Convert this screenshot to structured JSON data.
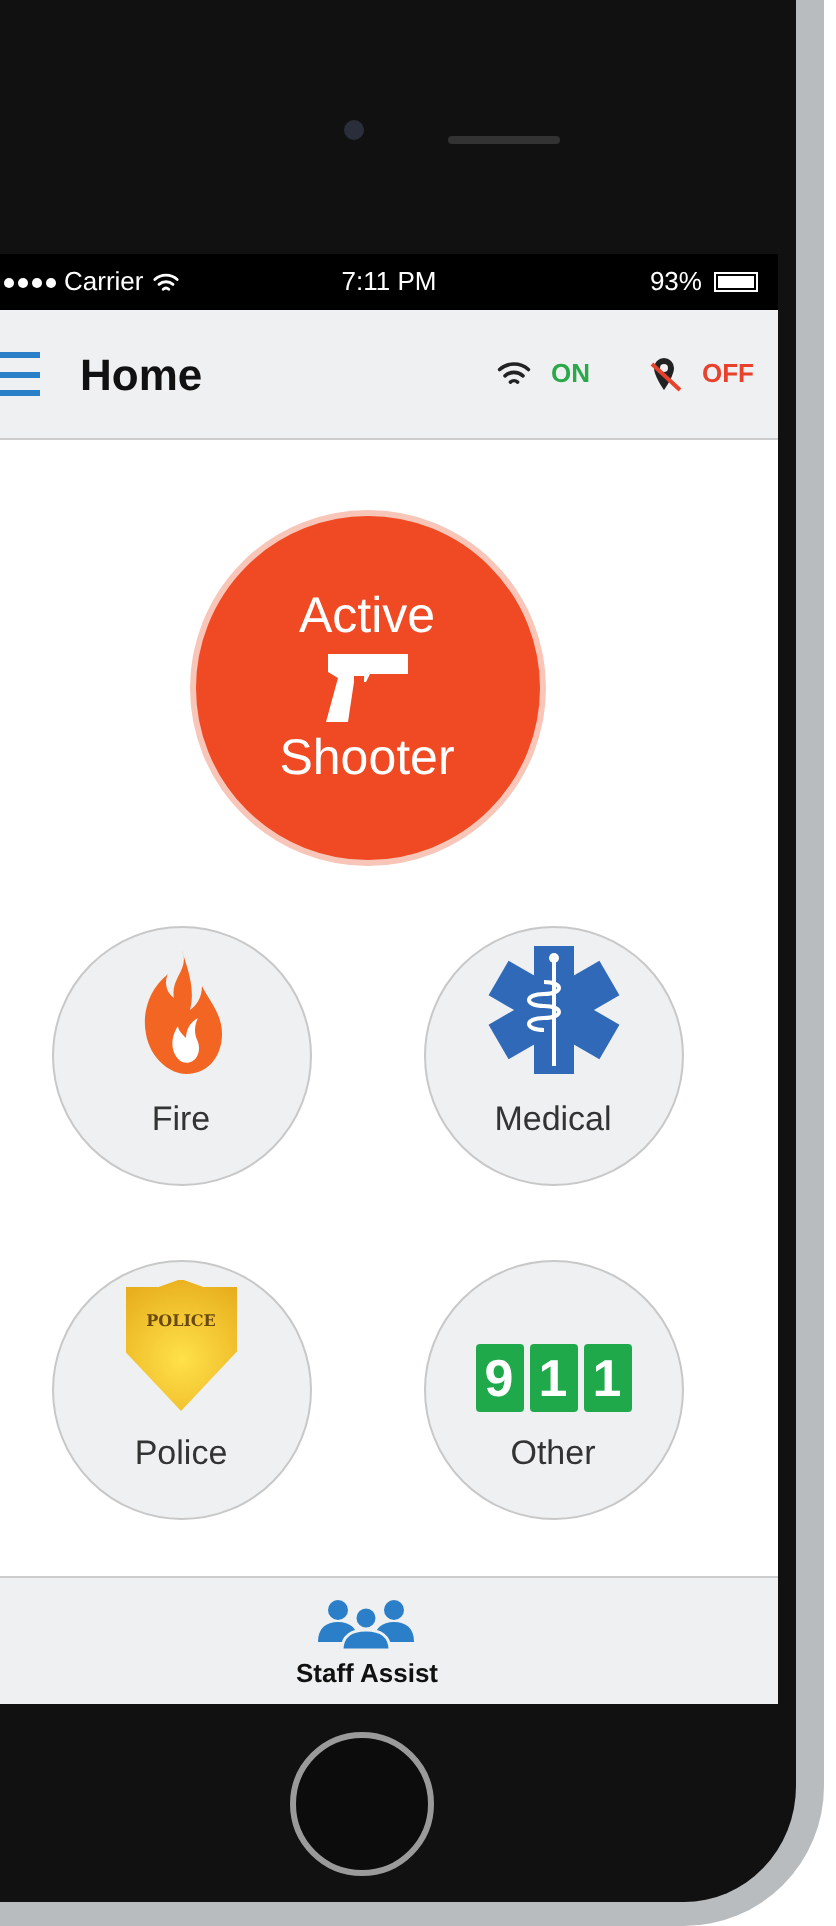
{
  "status_bar": {
    "carrier": "Carrier",
    "time": "7:11 PM",
    "battery": "93%"
  },
  "header": {
    "title": "Home",
    "indicators": [
      {
        "kind": "wifi",
        "label": "ON",
        "color": "#2aa84a"
      },
      {
        "kind": "location",
        "label": "OFF",
        "color": "#e8412c"
      }
    ]
  },
  "main_button": {
    "lines": [
      "Active",
      "Shooter"
    ]
  },
  "buttons": [
    {
      "kind": "fire",
      "label": "Fire"
    },
    {
      "kind": "medical",
      "label": "Medical"
    },
    {
      "kind": "police",
      "label": "Police",
      "badge_text": "POLICE"
    },
    {
      "kind": "other",
      "label": "Other",
      "digits": [
        "9",
        "1",
        "1"
      ]
    }
  ],
  "tab_bar": {
    "label": "Staff Assist"
  }
}
